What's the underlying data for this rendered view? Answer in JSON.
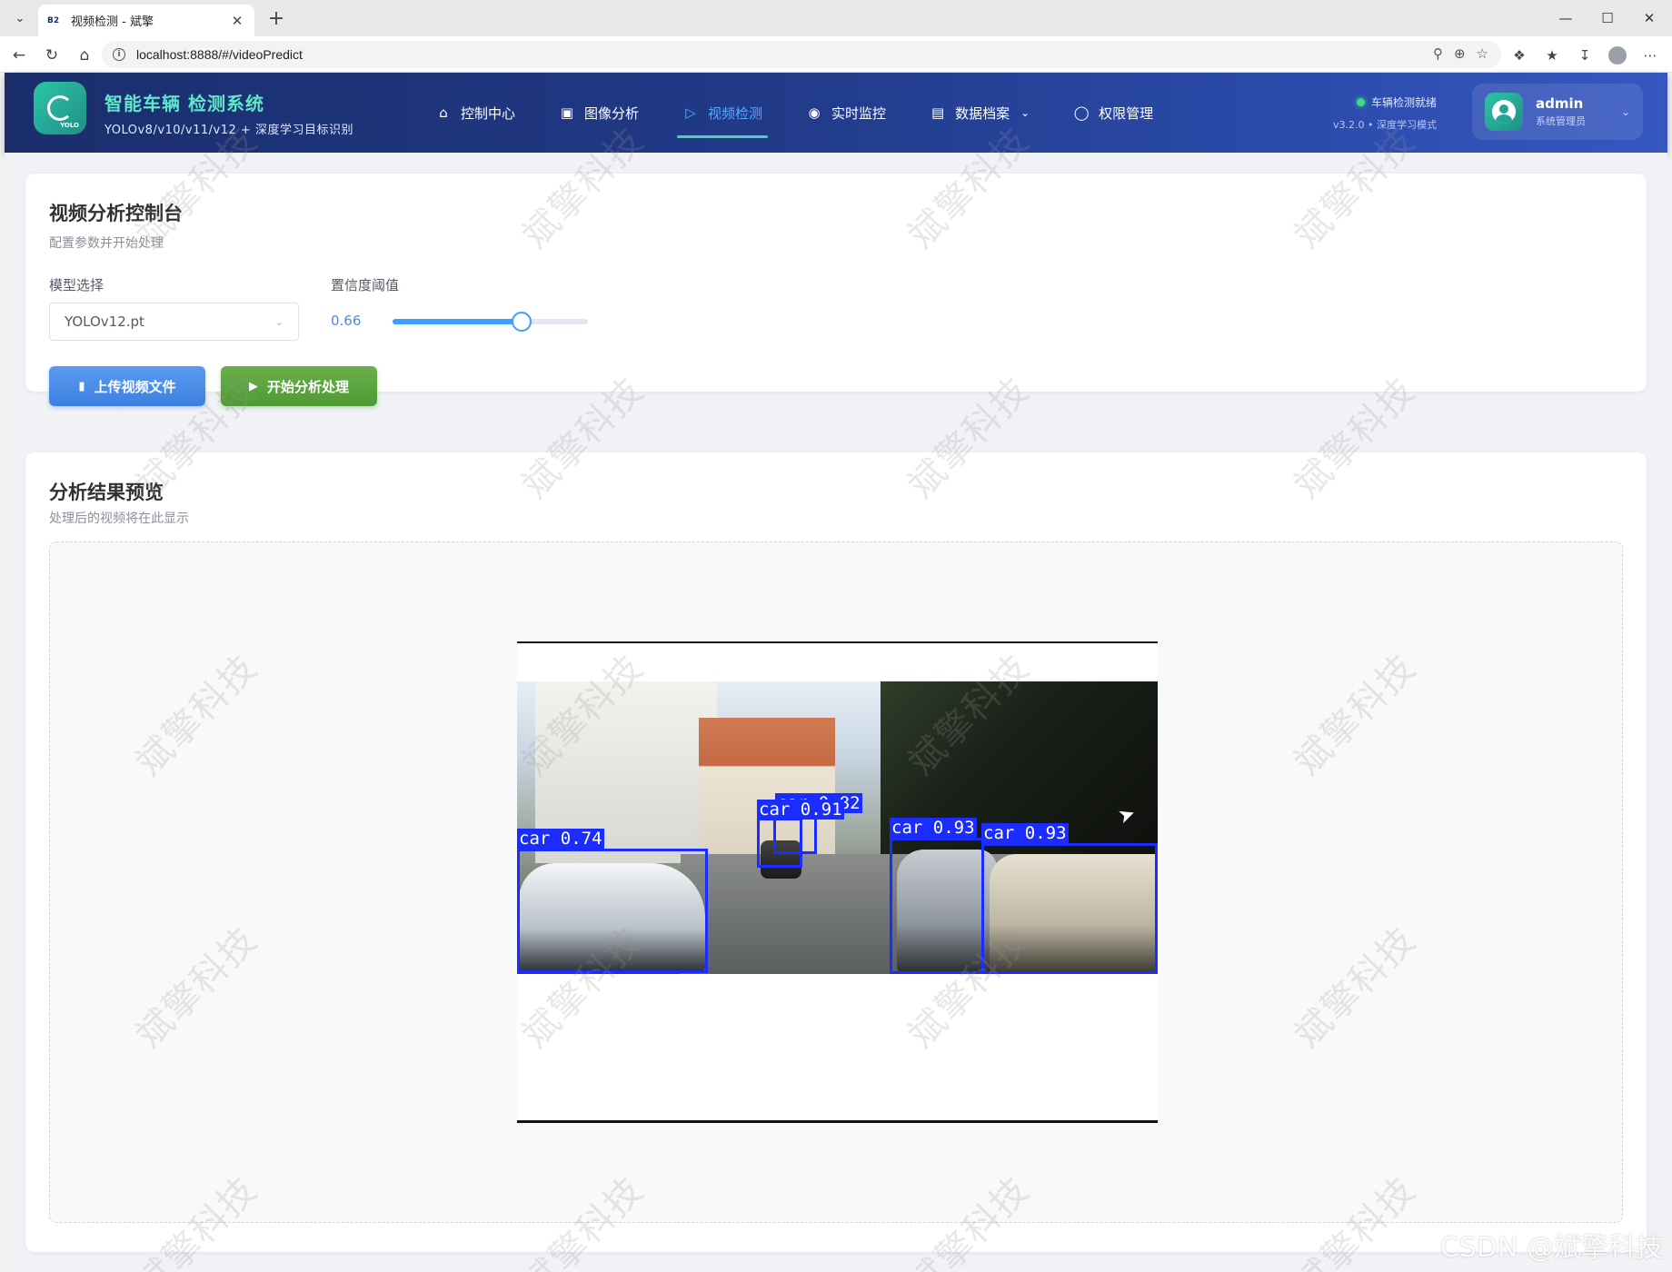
{
  "browser": {
    "tab_title": "视频检测 - 斌擎",
    "tab_favicon": "B2",
    "url": "localhost:8888/#/videoPredict"
  },
  "header": {
    "logo_badge": "YOLO",
    "title": "智能车辆 检测系统",
    "subtitle": "YOLOv8/v10/v11/v12 + 深度学习目标识别",
    "nav": [
      {
        "label": "控制中心",
        "icon": "home-icon",
        "active": false
      },
      {
        "label": "图像分析",
        "icon": "image-icon",
        "active": false
      },
      {
        "label": "视频检测",
        "icon": "play-circle-icon",
        "active": true
      },
      {
        "label": "实时监控",
        "icon": "camera-icon",
        "active": false
      },
      {
        "label": "数据档案",
        "icon": "document-icon",
        "active": false,
        "has_dropdown": true
      },
      {
        "label": "权限管理",
        "icon": "user-icon",
        "active": false
      }
    ],
    "status_text": "车辆检测就绪",
    "version_text": "v3.2.0 • 深度学习模式",
    "user_name": "admin",
    "user_role": "系统管理员"
  },
  "control": {
    "title": "视频分析控制台",
    "subtitle": "配置参数并开始处理",
    "model_label": "模型选择",
    "model_value": "YOLOv12.pt",
    "conf_label": "置信度阈值",
    "conf_value": "0.66",
    "conf_fraction": 0.66,
    "upload_label": "上传视频文件",
    "start_label": "开始分析处理"
  },
  "preview": {
    "title": "分析结果预览",
    "subtitle": "处理后的视频将在此显示",
    "detections": [
      {
        "label": "car 0.74"
      },
      {
        "label": "car 0.91"
      },
      {
        "label": "car 0.82"
      },
      {
        "label": "car 0.93"
      },
      {
        "label": "car 0.93"
      }
    ]
  },
  "watermark": "斌擎科技",
  "csdn_mark": "CSDN @斌擎科技",
  "colors": {
    "header_gradient_start": "#1a2e6c",
    "header_gradient_end": "#3657c0",
    "accent_teal": "#49d3b6",
    "active_nav": "#5aa8ff",
    "upload_button": "#3d7fe0",
    "start_button": "#4e9a33",
    "bbox": "#1a2cff"
  }
}
